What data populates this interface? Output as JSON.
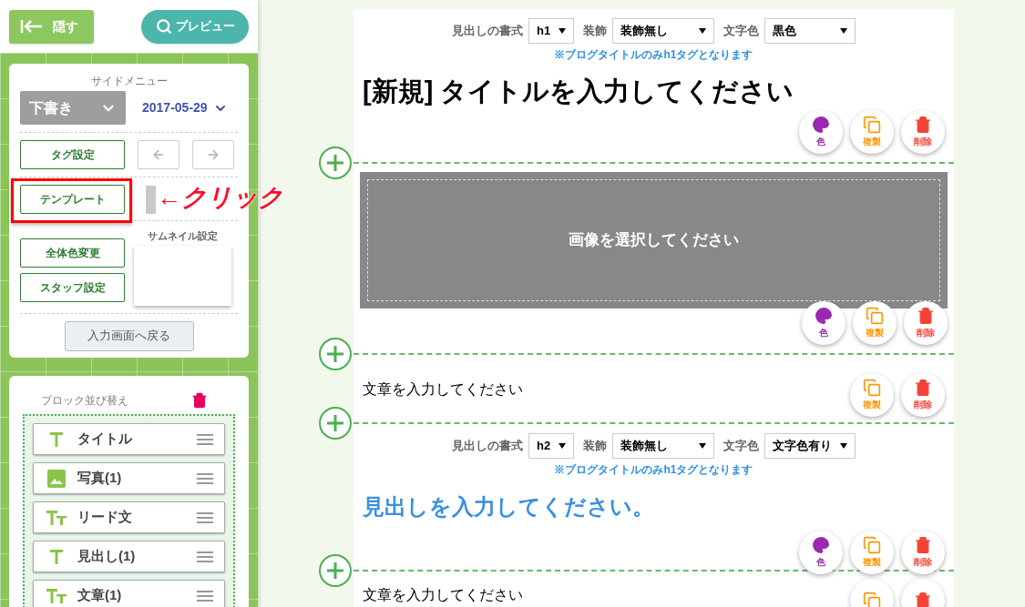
{
  "sidebar": {
    "hide_button": "隠す",
    "preview_button": "プレビュー",
    "menu": {
      "title": "サイドメニュー",
      "status_select": "下書き",
      "date": "2017-05-29",
      "tag_button": "タグ設定",
      "template_button": "テンプレート",
      "annotation": "←クリック",
      "thumbnail_label": "サムネイル設定",
      "color_button": "全体色変更",
      "staff_button": "スタッフ設定",
      "back_button": "入力画面へ戻る"
    },
    "sort": {
      "title": "ブロック並び替え",
      "items": [
        {
          "kind": "title",
          "label": "タイトル"
        },
        {
          "kind": "image",
          "label": "写真(1)"
        },
        {
          "kind": "lead",
          "label": "リード文"
        },
        {
          "kind": "title",
          "label": "見出し(1)"
        },
        {
          "kind": "lead",
          "label": "文章(1)"
        }
      ]
    }
  },
  "blocks": [
    {
      "kind": "heading",
      "format_label": "見出しの書式",
      "format_value": "h1",
      "decoration_label": "装飾",
      "decoration_value": "装飾無し",
      "color_label": "文字色",
      "color_value": "黒色",
      "note": "※ブログタイトルのみh1タグとなります",
      "text": "[新規] タイトルを入力してください",
      "colored": false,
      "actions": [
        {
          "kind": "color",
          "label": "色"
        },
        {
          "kind": "copy",
          "label": "複製"
        },
        {
          "kind": "delete",
          "label": "削除"
        }
      ]
    },
    {
      "kind": "image",
      "text": "画像を選択してください",
      "actions": [
        {
          "kind": "color",
          "label": "色"
        },
        {
          "kind": "copy",
          "label": "複製"
        },
        {
          "kind": "delete",
          "label": "削除"
        }
      ]
    },
    {
      "kind": "text",
      "text": "文章を入力してください",
      "actions": [
        {
          "kind": "copy",
          "label": "複製"
        },
        {
          "kind": "delete",
          "label": "削除"
        }
      ]
    },
    {
      "kind": "heading",
      "format_label": "見出しの書式",
      "format_value": "h2",
      "decoration_label": "装飾",
      "decoration_value": "装飾無し",
      "color_label": "文字色",
      "color_value": "文字色有り",
      "note": "※ブログタイトルのみh1タグとなります",
      "text": "見出しを入力してください。",
      "colored": true,
      "actions": [
        {
          "kind": "color",
          "label": "色"
        },
        {
          "kind": "copy",
          "label": "複製"
        },
        {
          "kind": "delete",
          "label": "削除"
        }
      ]
    },
    {
      "kind": "text",
      "text": "文章を入力してください",
      "actions": [
        {
          "kind": "copy"
        },
        {
          "kind": "delete"
        }
      ]
    }
  ]
}
